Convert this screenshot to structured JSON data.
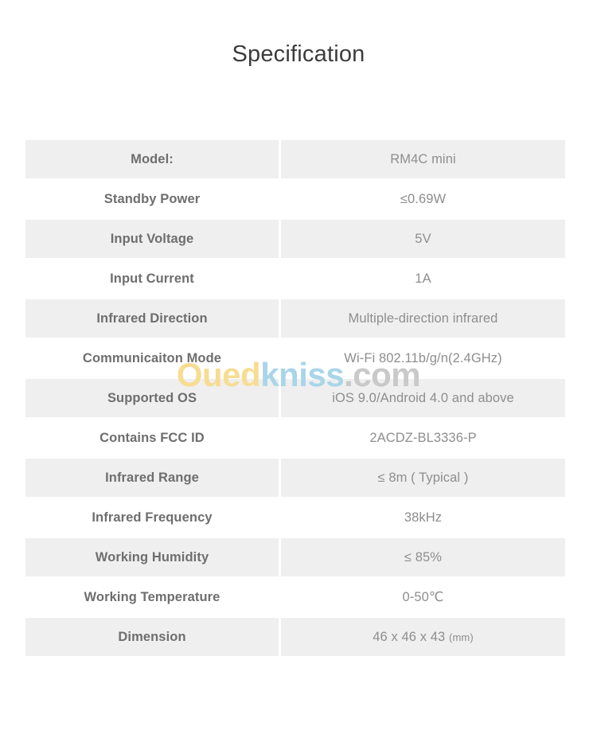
{
  "page": {
    "title": "Specification"
  },
  "watermark": {
    "part1": "Oued",
    "part2": "kniss",
    "part3": ".com",
    "color1": "#f7dc92",
    "color2": "#a9d5e9",
    "color3": "#c9c9c9"
  },
  "spec_table": {
    "rows": [
      {
        "label": "Model:",
        "value": "RM4C mini"
      },
      {
        "label": "Standby Power",
        "value": "≤0.69W"
      },
      {
        "label": "Input Voltage",
        "value": "5V"
      },
      {
        "label": "Input Current",
        "value": "1A"
      },
      {
        "label": "Infrared Direction",
        "value": "Multiple-direction infrared"
      },
      {
        "label": "Communicaiton Mode",
        "value": "Wi-Fi 802.11b/g/n(2.4GHz)"
      },
      {
        "label": "Supported OS",
        "value": "iOS 9.0/Android 4.0 and above"
      },
      {
        "label": "Contains FCC ID",
        "value": "2ACDZ-BL3336-P"
      },
      {
        "label": "Infrared Range",
        "value": "≤ 8m ( Typical )"
      },
      {
        "label": "Infrared Frequency",
        "value": "38kHz"
      },
      {
        "label": "Working Humidity",
        "value": "≤ 85%"
      },
      {
        "label": "Working Temperature",
        "value": "0-50℃"
      },
      {
        "label": "Dimension",
        "value": "46 x 46 x 43",
        "value_unit": "(mm)"
      }
    ]
  }
}
